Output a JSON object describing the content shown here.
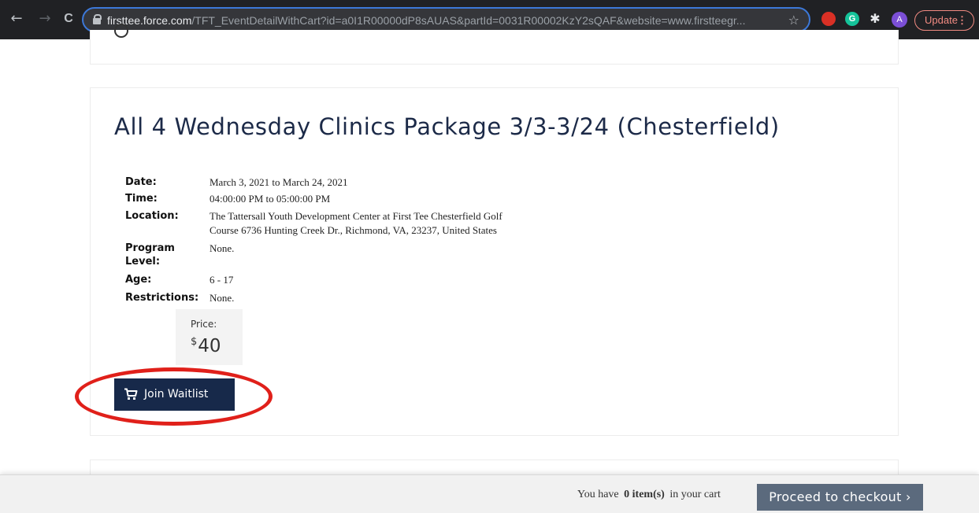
{
  "browser": {
    "back_glyph": "←",
    "forward_glyph": "→",
    "reload_glyph": "C",
    "url_host": "firsttee.force.com",
    "url_path": "/TFT_EventDetailWithCart?id=a0I1R00000dP8sAUAS&partId=0031R00002KzY2sQAF&website=www.firstteegr...",
    "star_glyph": "☆",
    "ext_g_letter": "G",
    "puzzle_glyph": "✱",
    "avatar_letter": "A",
    "update_label": "Update",
    "menu_glyph": "⋮"
  },
  "event": {
    "title": "All 4 Wednesday Clinics Package 3/3-3/24 (Chesterfield)",
    "details": [
      {
        "label": "Date:",
        "value": "March 3, 2021 to March 24, 2021"
      },
      {
        "label": "Time:",
        "value": "04:00:00 PM to 05:00:00 PM"
      },
      {
        "label": "Location:",
        "value_line1": "The Tattersall Youth Development Center at First Tee Chesterfield Golf",
        "value_line2": "Course 6736 Hunting Creek Dr., Richmond, VA, 23237, United States"
      },
      {
        "label_line1": "Program",
        "label_line2": "Level:",
        "value": "None."
      },
      {
        "label": "Age:",
        "value": "6 - 17"
      },
      {
        "label": "Restrictions:",
        "value": "None."
      }
    ],
    "price_label": "Price:",
    "price_currency": "$",
    "price_amount": "40",
    "join_label": "Join Waitlist"
  },
  "cart": {
    "prefix": "You have",
    "count": "0 item(s)",
    "suffix": "in your cart",
    "checkout_label": "Proceed to checkout ›"
  },
  "colors": {
    "title": "#1c2a48",
    "join_button": "#17294a",
    "checkout_button": "#5b6a7d",
    "highlight": "#e0201a"
  }
}
